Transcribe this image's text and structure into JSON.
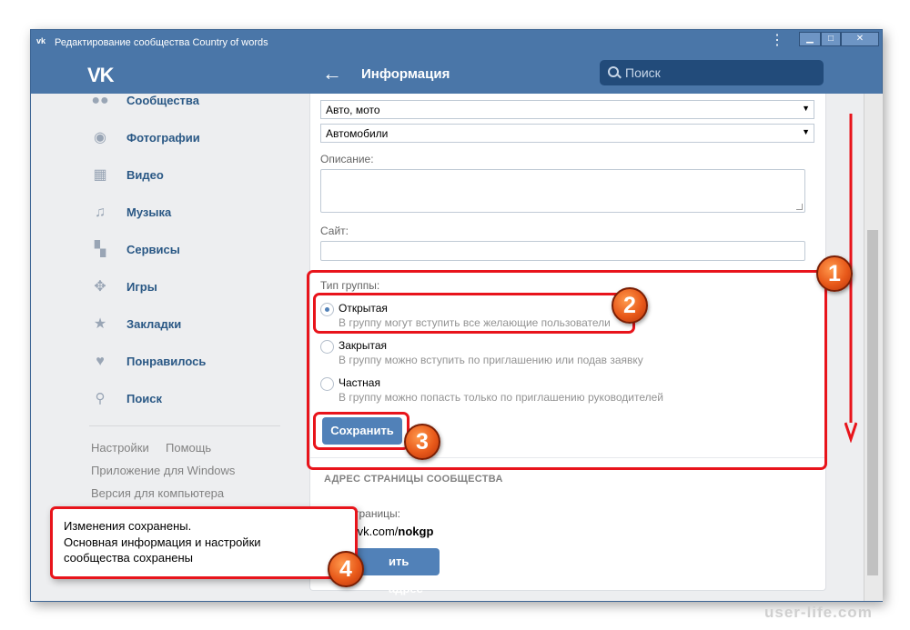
{
  "window": {
    "title": "Редактирование сообщества Country of words",
    "title_icon": "vk-icon",
    "menu_icon": "⋮"
  },
  "header": {
    "logo": "VK",
    "title": "Информация",
    "search_placeholder": "Поиск"
  },
  "sidebar": {
    "items": [
      {
        "label": "Сообщества",
        "icon": "communities-icon"
      },
      {
        "label": "Фотографии",
        "icon": "camera-icon"
      },
      {
        "label": "Видео",
        "icon": "video-icon"
      },
      {
        "label": "Музыка",
        "icon": "music-icon"
      },
      {
        "label": "Сервисы",
        "icon": "services-icon"
      },
      {
        "label": "Игры",
        "icon": "gamepad-icon"
      },
      {
        "label": "Закладки",
        "icon": "star-icon"
      },
      {
        "label": "Понравилось",
        "icon": "heart-icon"
      },
      {
        "label": "Поиск",
        "icon": "search-icon"
      }
    ],
    "footer": {
      "settings": "Настройки",
      "help": "Помощь",
      "windows_app": "Приложение для Windows",
      "desktop_version": "Версия для компьютера"
    }
  },
  "form": {
    "category1": "Авто, мото",
    "category2": "Автомобили",
    "description_label": "Описание:",
    "site_label": "Сайт:",
    "group_type_label": "Тип группы:",
    "types": [
      {
        "label": "Открытая",
        "desc": "В группу могут вступить все желающие пользователи",
        "selected": true
      },
      {
        "label": "Закрытая",
        "desc": "В группу можно вступить по приглашению или подав заявку",
        "selected": false
      },
      {
        "label": "Частная",
        "desc": "В группу можно попасть только по приглашению руководителей",
        "selected": false
      }
    ],
    "save_button": "Сохранить"
  },
  "address": {
    "section_title": "АДРЕС СТРАНИЦЫ СООБЩЕСТВА",
    "label": "траницы:",
    "url_prefix": ".vk.com/",
    "url_slug": "nokgp",
    "button": "ить адрес"
  },
  "toast": {
    "line1": "Изменения сохранены.",
    "line2": "Основная информация и настройки",
    "line3": "сообщества сохранены"
  },
  "annotations": {
    "b1": "1",
    "b2": "2",
    "b3": "3",
    "b4": "4",
    "color": "#e8141b"
  },
  "watermark": "user-life.com",
  "colors": {
    "accent": "#4a76a8",
    "button": "#5181b8",
    "link": "#2a5885"
  }
}
